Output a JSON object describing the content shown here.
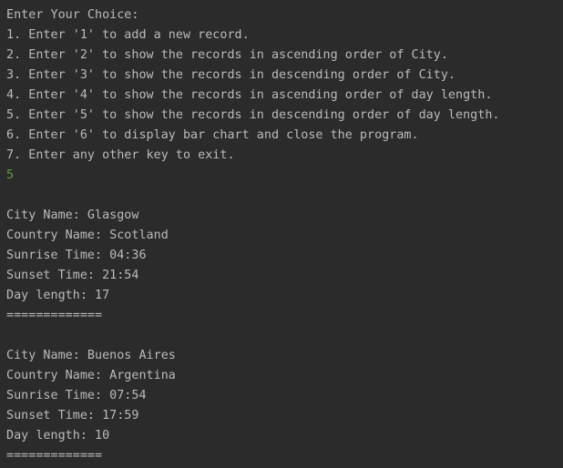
{
  "menu": {
    "prompt": "Enter Your Choice:",
    "options": [
      "1. Enter '1' to add a new record.",
      "2. Enter '2' to show the records in ascending order of City.",
      "3. Enter '3' to show the records in descending order of City.",
      "4. Enter '4' to show the records in ascending order of day length.",
      "5. Enter '5' to show the records in descending order of day length.",
      "6. Enter '6' to display bar chart and close the program.",
      "7. Enter any other key to exit."
    ],
    "user_input": "5"
  },
  "records": [
    {
      "city": "City Name: Glasgow",
      "country": "Country Name: Scotland",
      "sunrise": "Sunrise Time: 04:36",
      "sunset": "Sunset Time: 21:54",
      "day_length": "Day length: 17",
      "separator": "============="
    },
    {
      "city": "City Name: Buenos Aires",
      "country": "Country Name: Argentina",
      "sunrise": "Sunrise Time: 07:54",
      "sunset": "Sunset Time: 17:59",
      "day_length": "Day length: 10",
      "separator": "============="
    }
  ],
  "colors": {
    "background": "#2b2b2b",
    "text": "#bbbbbb",
    "user_input": "#5c9e3a"
  }
}
